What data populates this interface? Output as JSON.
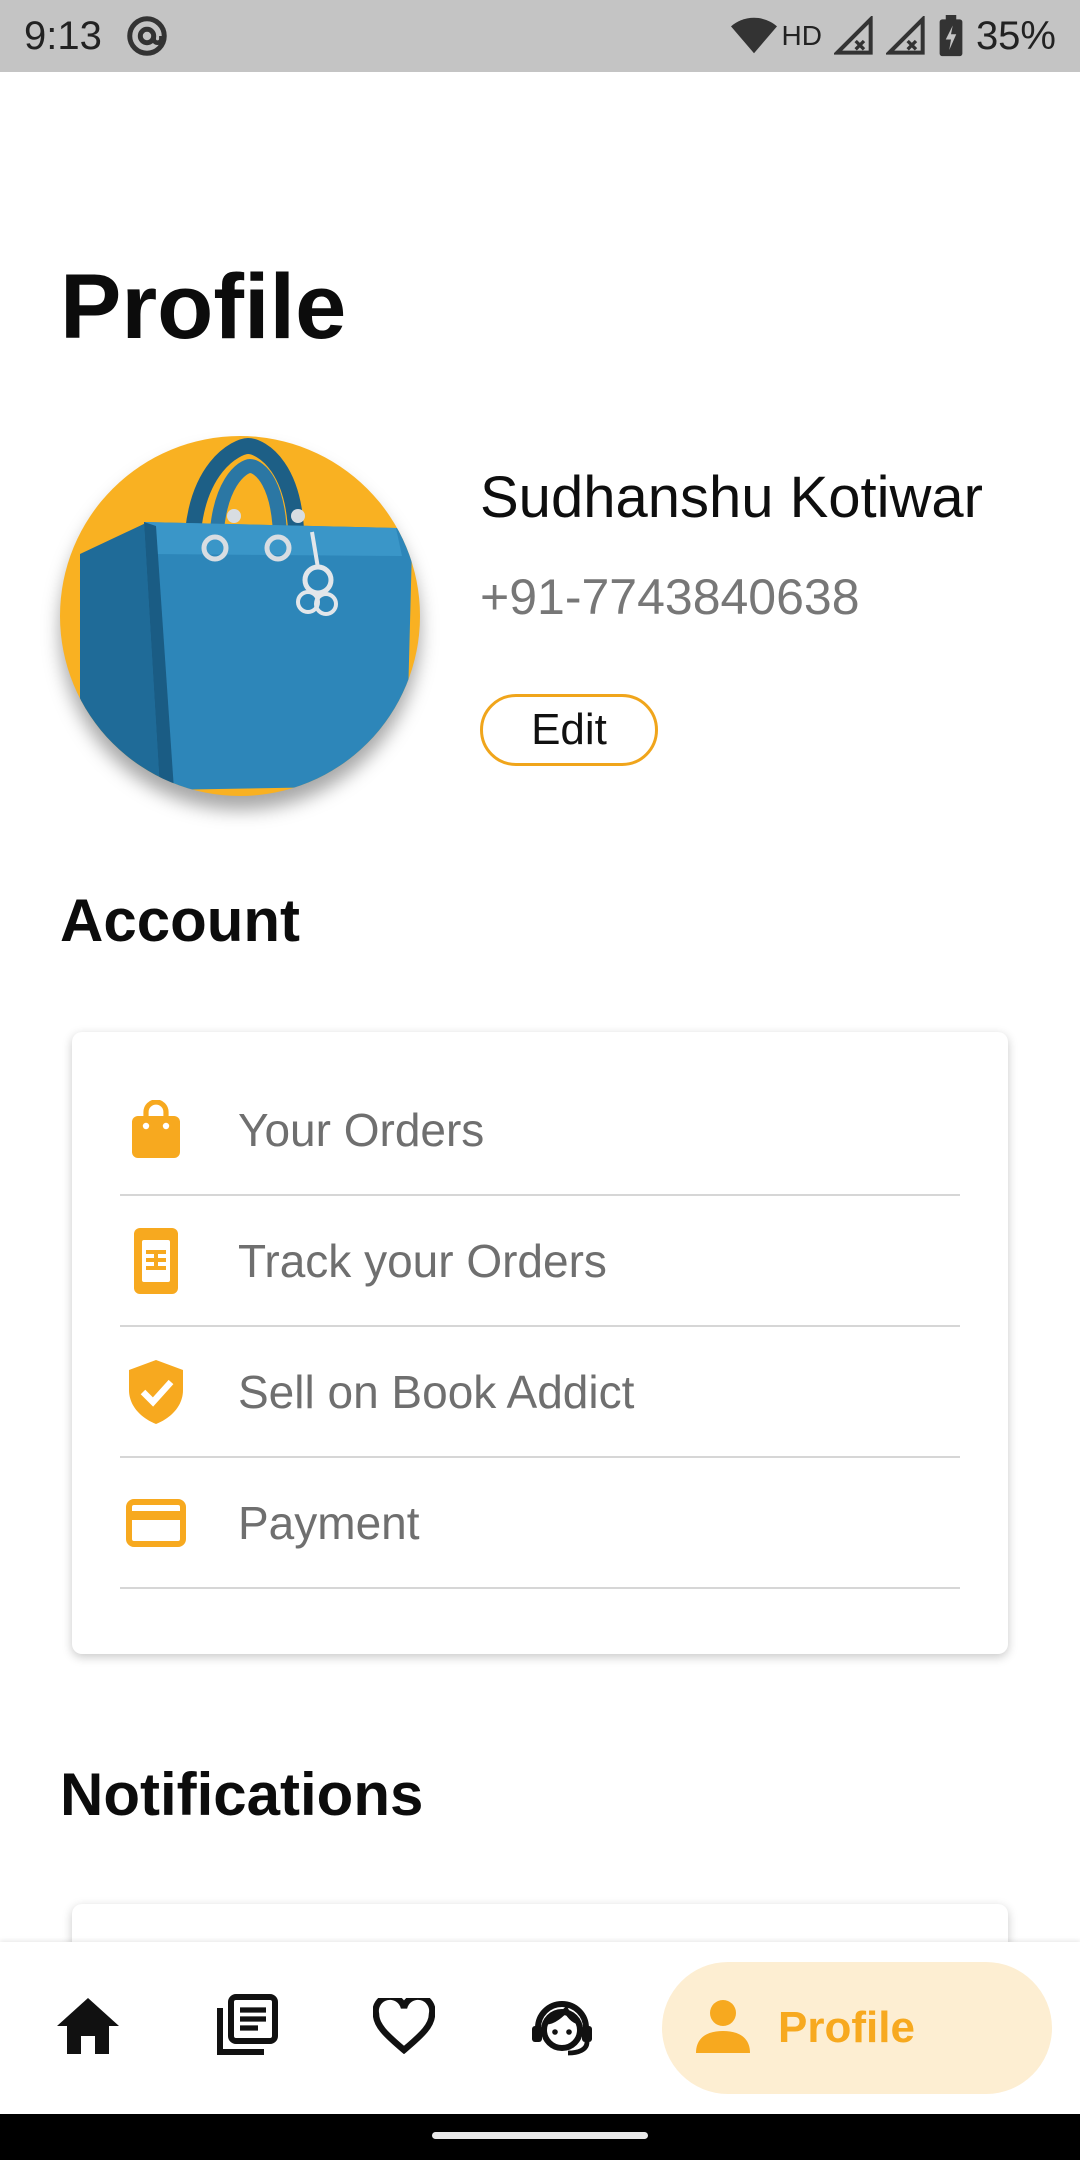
{
  "status_bar": {
    "time": "9:13",
    "network_type": "HD",
    "battery": "35%",
    "icons": [
      "at-sign-icon",
      "wifi-icon",
      "signal-icon",
      "signal-icon",
      "battery-charging-icon"
    ]
  },
  "page": {
    "title": "Profile"
  },
  "profile": {
    "avatar_icon": "handbag-avatar",
    "name": "Sudhanshu Kotiwar",
    "phone": "+91-7743840638",
    "edit_label": "Edit"
  },
  "account": {
    "heading": "Account",
    "items": [
      {
        "label": "Your Orders",
        "icon": "shopping-bag-icon"
      },
      {
        "label": "Track your Orders",
        "icon": "receipt-icon"
      },
      {
        "label": "Sell on Book Addict",
        "icon": "verified-shield-icon"
      },
      {
        "label": "Payment",
        "icon": "credit-card-icon"
      }
    ]
  },
  "notifications": {
    "heading": "Notifications"
  },
  "bottom_nav": {
    "items": [
      {
        "icon": "home-icon"
      },
      {
        "icon": "library-icon"
      },
      {
        "icon": "heart-icon"
      },
      {
        "icon": "support-agent-icon"
      }
    ],
    "active": {
      "icon": "person-icon",
      "label": "Profile"
    }
  },
  "colors": {
    "accent": "#f7a91f",
    "accent_light": "#fdeed2",
    "avatar_bg": "#f9b122",
    "muted_text": "#6f6f6f",
    "status_bar": "#c4c4c4"
  }
}
